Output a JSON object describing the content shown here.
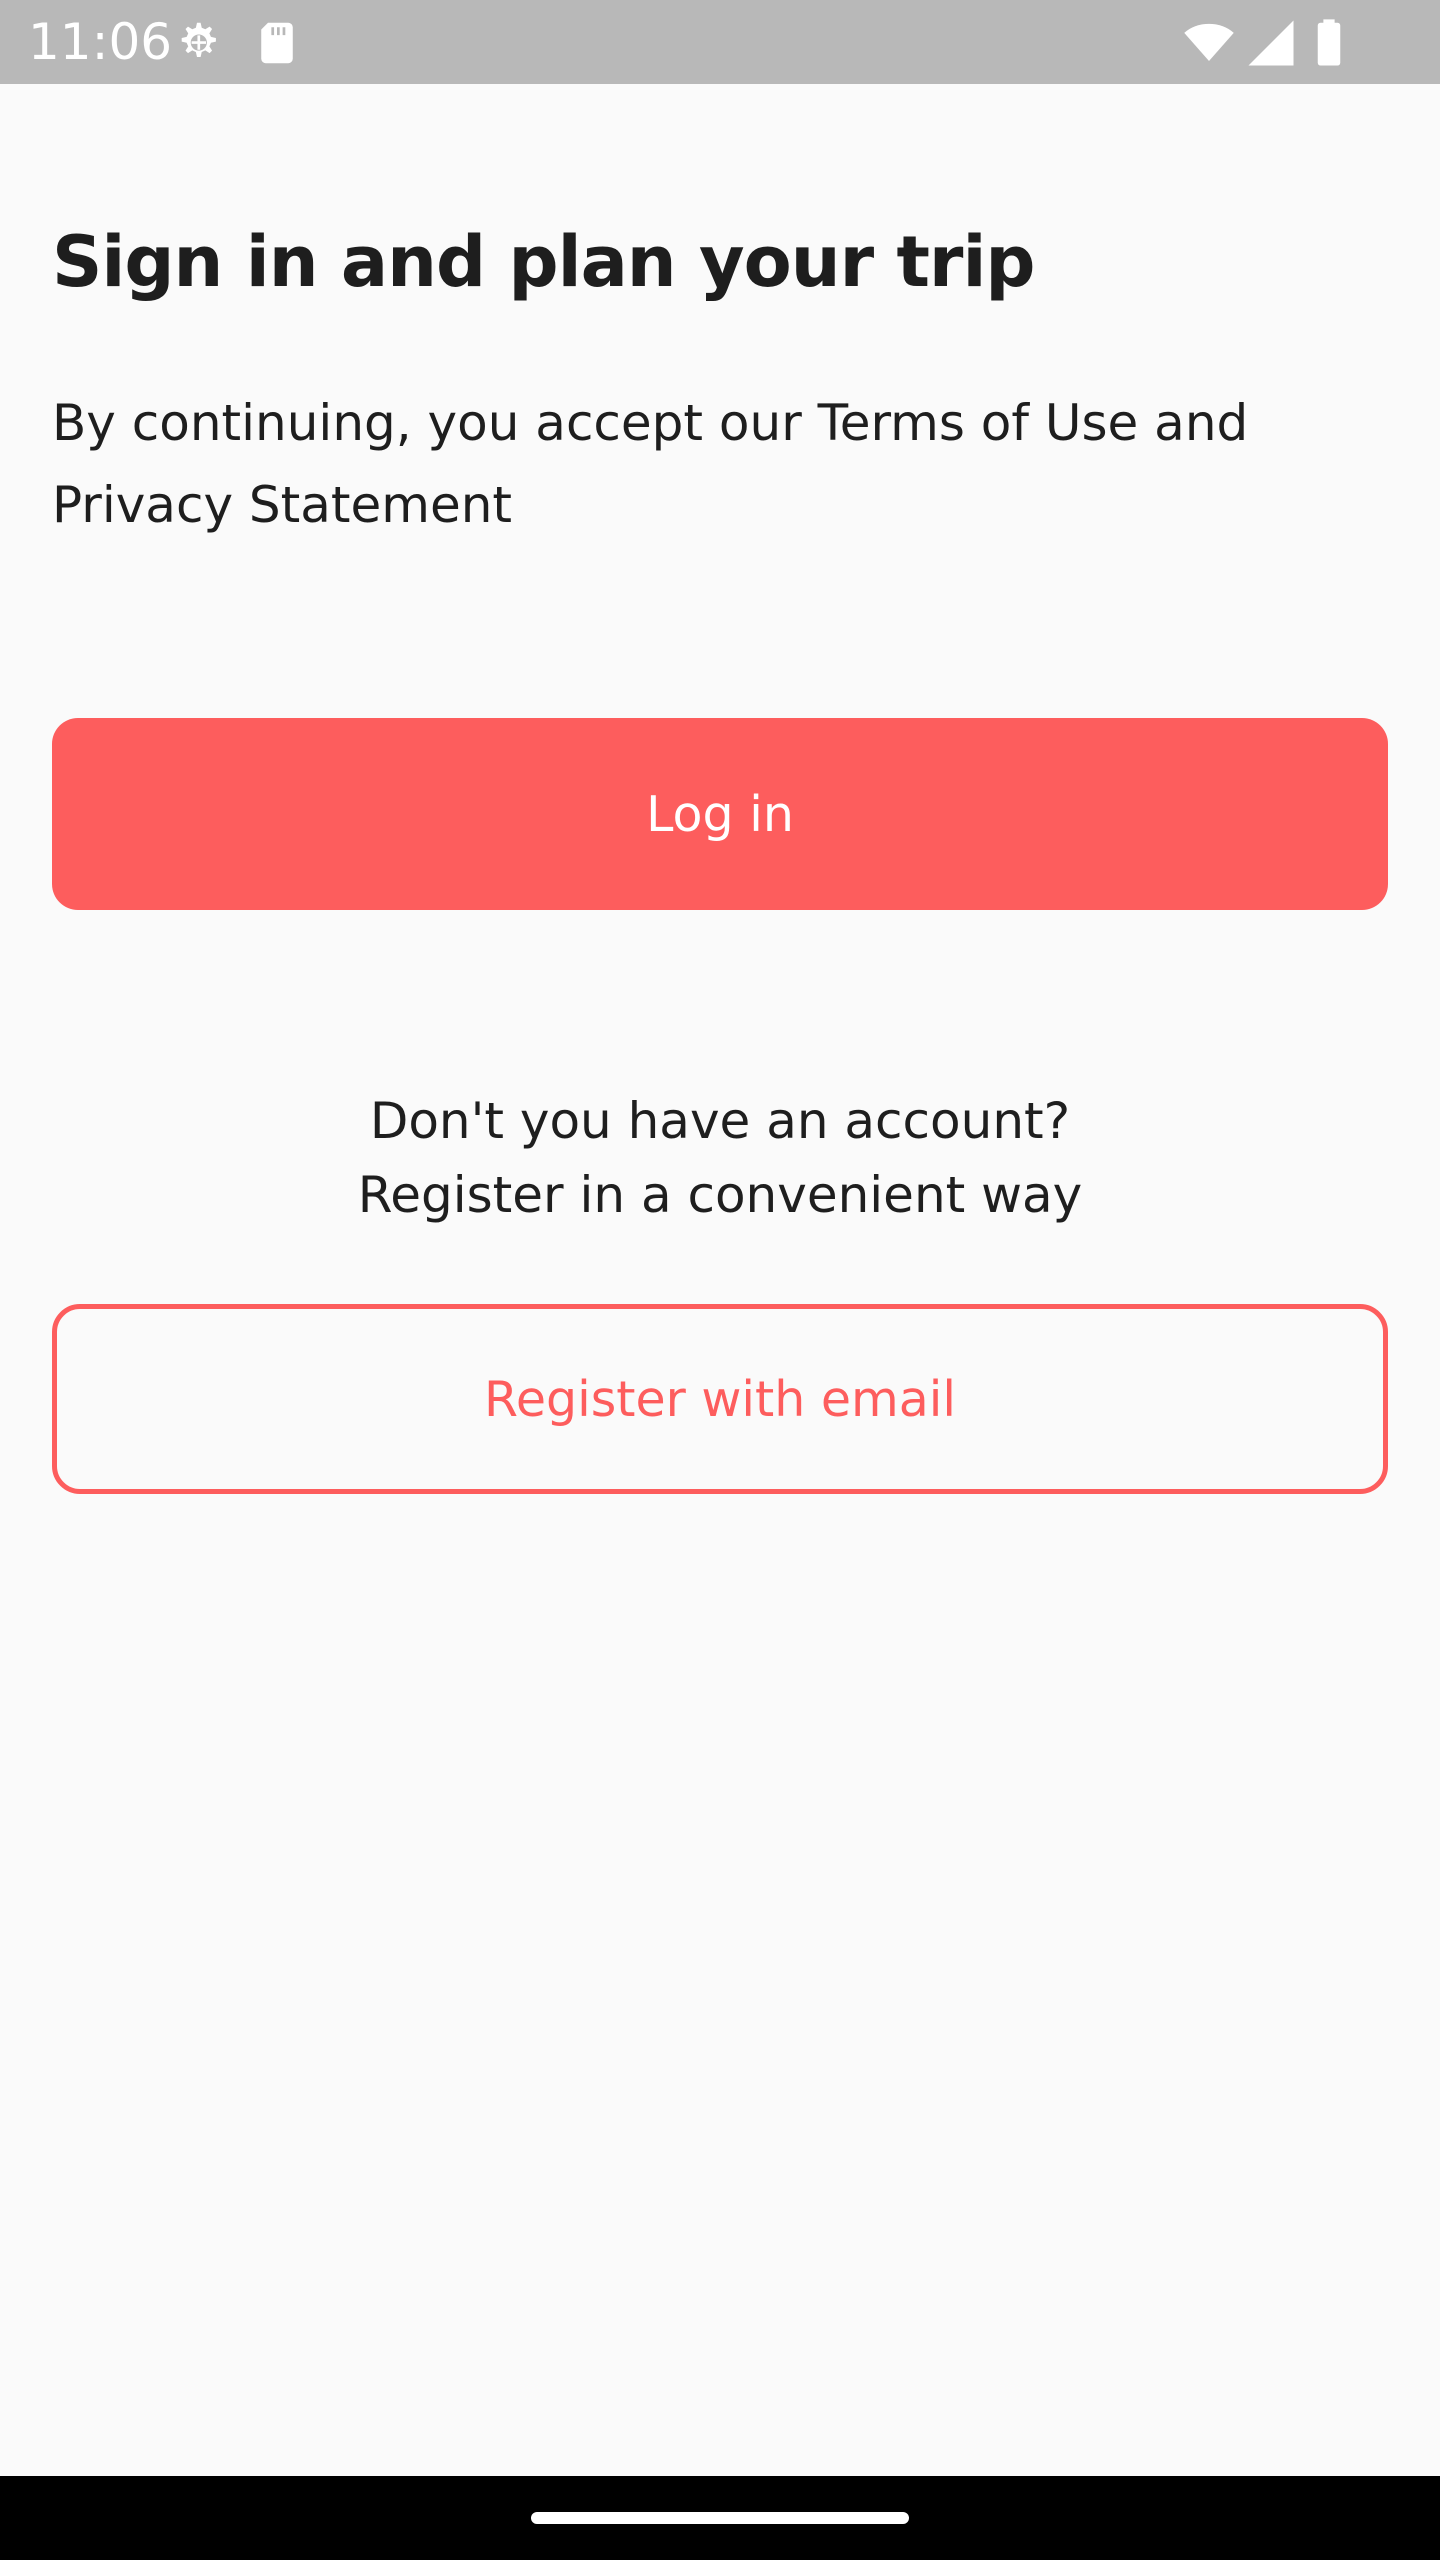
{
  "status_bar": {
    "time": "11:06",
    "icons": [
      "settings-gear-icon",
      "sd-card-icon",
      "wifi-icon",
      "cell-signal-icon",
      "battery-icon"
    ]
  },
  "main": {
    "title": "Sign in and plan your trip",
    "terms_text": "By continuing, you accept our Terms of Use and Privacy Statement",
    "login_button_label": "Log in",
    "register_prompt_line1": "Don't you have an account?",
    "register_prompt_line2": "Register in a convenient way",
    "register_button_label": "Register with email"
  },
  "colors": {
    "accent": "#fd5d5d",
    "background": "#fafafa",
    "status_bar": "#b8b8b8",
    "text": "#1e1e1e"
  }
}
